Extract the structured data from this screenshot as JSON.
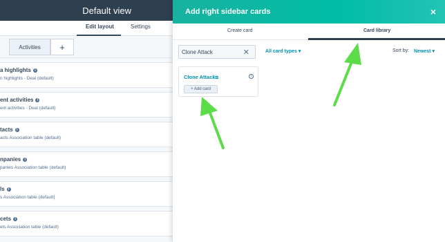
{
  "left_panel": {
    "header_title": "Default view",
    "subnav": {
      "edit_layout": "Edit layout",
      "settings": "Settings"
    },
    "activities_tab": "Activities",
    "add_tab": "+",
    "sections": [
      {
        "title": "a highlights",
        "sub": "n highlights - Deal (default)"
      },
      {
        "title": "ent activities",
        "sub": "ent activities - Deal (default)"
      },
      {
        "title": "tacts",
        "sub": "acts Association table (default)"
      },
      {
        "title": "npanies",
        "sub": "panies Association table (default)"
      },
      {
        "title": "ls",
        "sub": "s Association table (default)"
      },
      {
        "title": "cets",
        "sub": "ets Association table (default)"
      }
    ]
  },
  "right_panel": {
    "title": "Add right sidebar cards",
    "close_icon": "×",
    "tabs": {
      "create": "Create card",
      "library": "Card library"
    },
    "search": {
      "value": "Clone Attack",
      "clear": "✕"
    },
    "filter_label": "All card types ▾",
    "sort_label": "Sort by:",
    "sort_value": "Newest ▾",
    "card": {
      "title": "Clone Attack",
      "external_icon": "⧉",
      "info_icon": "i",
      "add_label": "+ Add card"
    }
  },
  "colors": {
    "header_dark": "#2e3f50",
    "header_teal": "#00bda5",
    "link_blue": "#0091ae",
    "annotation_arrow": "#5ddc4a"
  }
}
